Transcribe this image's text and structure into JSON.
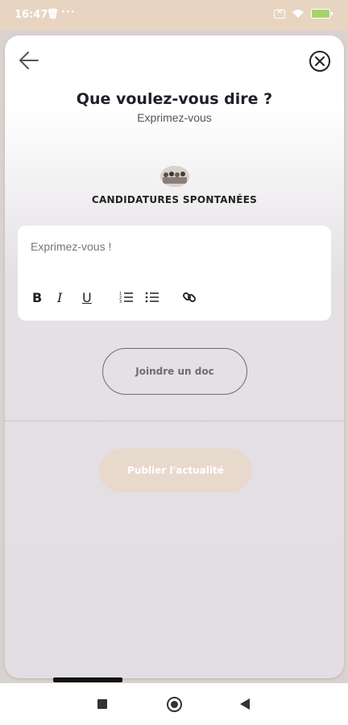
{
  "status_bar": {
    "time": "16:47",
    "trash_icon": "trash-icon",
    "dots": "···",
    "sim_icon": "sim-off-icon",
    "wifi_icon": "wifi-icon",
    "battery_icon": "battery-icon"
  },
  "header": {
    "back_icon": "arrow-left-icon",
    "close_icon": "close-circle-icon",
    "title": "Que voulez-vous dire ?",
    "subtitle": "Exprimez-vous"
  },
  "group": {
    "avatar_icon": "group-photo",
    "name": "CANDIDATURES SPONTANÉES"
  },
  "editor": {
    "placeholder": "Exprimez-vous !",
    "toolbar": {
      "bold": "B",
      "italic": "I",
      "underline": "U",
      "ordered_list_icon": "ordered-list-icon",
      "bullet_list_icon": "bullet-list-icon",
      "link_icon": "link-icon"
    }
  },
  "actions": {
    "attach_label": "Joindre un doc",
    "publish_label": "Publier l'actualité"
  },
  "colors": {
    "accent": "#e8d9cd",
    "status_bar": "#e7d5c2",
    "title": "#1f1f2a",
    "outline_button": "#6d6c74"
  }
}
